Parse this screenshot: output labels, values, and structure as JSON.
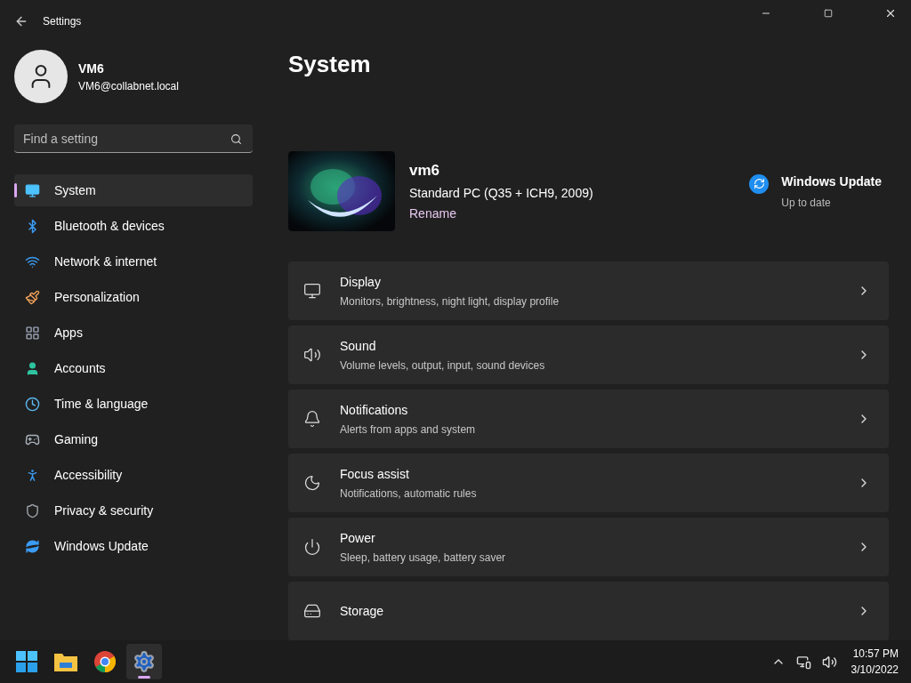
{
  "window": {
    "title": "Settings"
  },
  "account": {
    "name": "VM6",
    "email": "VM6@collabnet.local"
  },
  "search": {
    "placeholder": "Find a setting"
  },
  "nav": [
    {
      "label": "System",
      "selected": true
    },
    {
      "label": "Bluetooth & devices",
      "selected": false
    },
    {
      "label": "Network & internet",
      "selected": false
    },
    {
      "label": "Personalization",
      "selected": false
    },
    {
      "label": "Apps",
      "selected": false
    },
    {
      "label": "Accounts",
      "selected": false
    },
    {
      "label": "Time & language",
      "selected": false
    },
    {
      "label": "Gaming",
      "selected": false
    },
    {
      "label": "Accessibility",
      "selected": false
    },
    {
      "label": "Privacy & security",
      "selected": false
    },
    {
      "label": "Windows Update",
      "selected": false
    }
  ],
  "page": {
    "title": "System"
  },
  "device": {
    "name": "vm6",
    "model": "Standard PC (Q35 + ICH9, 2009)",
    "rename": "Rename"
  },
  "update": {
    "title": "Windows Update",
    "status": "Up to date"
  },
  "cards": [
    {
      "title": "Display",
      "subtitle": "Monitors, brightness, night light, display profile"
    },
    {
      "title": "Sound",
      "subtitle": "Volume levels, output, input, sound devices"
    },
    {
      "title": "Notifications",
      "subtitle": "Alerts from apps and system"
    },
    {
      "title": "Focus assist",
      "subtitle": "Notifications, automatic rules"
    },
    {
      "title": "Power",
      "subtitle": "Sleep, battery usage, battery saver"
    },
    {
      "title": "Storage"
    }
  ],
  "taskbar": {
    "apps": [
      {
        "selected": false
      },
      {
        "selected": false
      },
      {
        "selected": false
      },
      {
        "selected": true
      }
    ],
    "time": "10:57 PM",
    "date": "3/10/2022"
  }
}
